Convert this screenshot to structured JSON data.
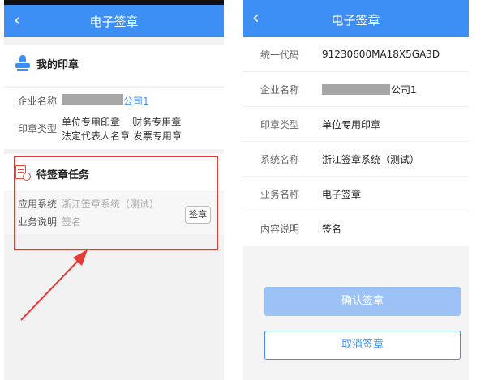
{
  "left": {
    "title": "电子签章",
    "my_seals": {
      "heading": "我的印章",
      "company_label": "企业名称",
      "company_value": "公司1",
      "seal_type_label": "印章类型",
      "seal_types_line1": "单位专用印章    财务专用章",
      "seal_types_line2": "法定代表人名章 发票专用章"
    },
    "pending": {
      "heading": "待签章任务",
      "app_label": "应用系统",
      "app_value": "浙江签章系统（测试）",
      "desc_label": "业务说明",
      "desc_value": "签名",
      "sign_button": "签章"
    }
  },
  "right": {
    "title": "电子签章",
    "rows": [
      {
        "label": "统一代码",
        "value": "91230600MA18X5GA3D"
      },
      {
        "label": "企业名称",
        "value": "公司1"
      },
      {
        "label": "印章类型",
        "value": "单位专用印章"
      },
      {
        "label": "系统名称",
        "value": "浙江签章系统（测试）"
      },
      {
        "label": "业务名称",
        "value": "电子签章"
      },
      {
        "label": "内容说明",
        "value": "签名"
      }
    ],
    "confirm_button": "确认签章",
    "cancel_button": "取消签章"
  },
  "colors": {
    "nav_blue": "#3d8ff5",
    "annotation_red": "#e53935",
    "confirm_disabled": "#9dc3f6"
  },
  "icons": [
    "back-arrow-icon",
    "seal-icon",
    "pending-task-icon",
    "pointer-arrow"
  ]
}
